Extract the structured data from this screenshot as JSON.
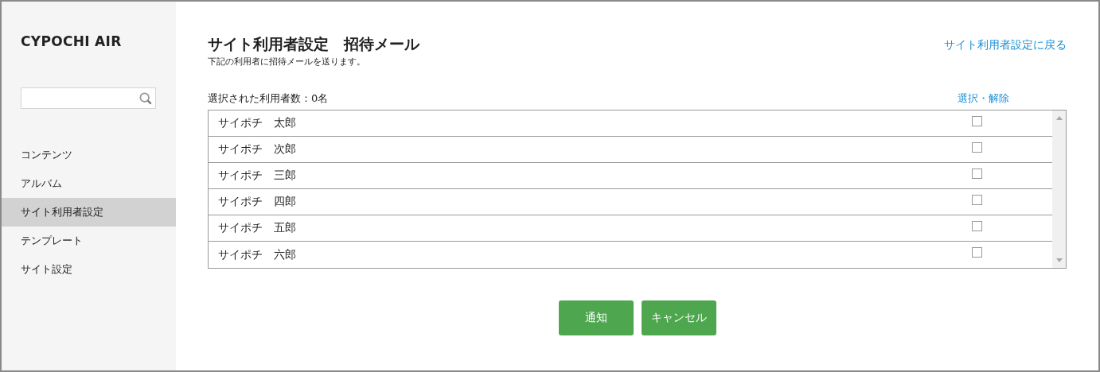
{
  "sidebar": {
    "logo": "CYPOCHI AIR",
    "items": [
      {
        "label": "コンテンツ",
        "selected": false
      },
      {
        "label": "アルバム",
        "selected": false
      },
      {
        "label": "サイト利用者設定",
        "selected": true
      },
      {
        "label": "テンプレート",
        "selected": false
      },
      {
        "label": "サイト設定",
        "selected": false
      }
    ]
  },
  "header": {
    "title": "サイト利用者設定　招待メール",
    "subtitle": "下記の利用者に招待メールを送ります。",
    "back_link": "サイト利用者設定に戻る"
  },
  "selection": {
    "count_label": "選択された利用者数：0名",
    "toggle_link": "選択・解除"
  },
  "users": [
    {
      "name": "サイポチ　太郎",
      "checked": false
    },
    {
      "name": "サイポチ　次郎",
      "checked": false
    },
    {
      "name": "サイポチ　三郎",
      "checked": false
    },
    {
      "name": "サイポチ　四郎",
      "checked": false
    },
    {
      "name": "サイポチ　五郎",
      "checked": false
    },
    {
      "name": "サイポチ　六郎",
      "checked": false
    }
  ],
  "buttons": [
    "通知",
    "キャンセル"
  ]
}
